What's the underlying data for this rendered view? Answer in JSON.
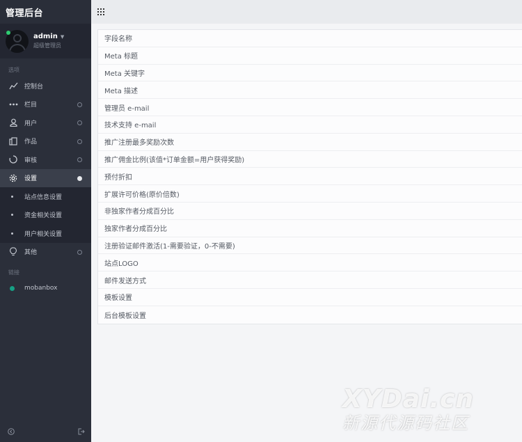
{
  "brand": {
    "title": "管理后台"
  },
  "profile": {
    "name": "admin",
    "role": "超级管理员"
  },
  "sidebar": {
    "section_options": "选项",
    "items": [
      {
        "label": "控制台",
        "icon": "chart-line-icon"
      },
      {
        "label": "栏目",
        "icon": "dots-icon"
      },
      {
        "label": "用户",
        "icon": "user-icon"
      },
      {
        "label": "作品",
        "icon": "copy-icon"
      },
      {
        "label": "审核",
        "icon": "spinner-icon"
      },
      {
        "label": "设置",
        "icon": "gear-icon"
      }
    ],
    "sub_items": [
      "站点信息设置",
      "资金相关设置",
      "用户相关设置"
    ],
    "other_label": "其他",
    "section_links": "链接",
    "link_label": "mobanbox"
  },
  "fields": [
    "字段名称",
    "Meta 标题",
    "Meta 关键字",
    "Meta 描述",
    "管理员 e-mail",
    "技术支持 e-mail",
    "推广注册最多奖励次数",
    "推广佣金比例(该值*订单金额=用户获得奖励)",
    "预付折扣",
    "扩展许可价格(原价倍数)",
    "非独家作者分成百分比",
    "独家作者分成百分比",
    "注册验证邮件激活(1-需要验证，0-不需要)",
    "站点LOGO",
    "邮件发送方式",
    "模板设置",
    "后台模板设置"
  ],
  "watermark": {
    "line1": "XYDai.cn",
    "line2": "新源代源码社区"
  },
  "colors": {
    "sidebar_bg": "#2b2f3a",
    "active_bg": "#3a3f4b",
    "online": "#2ecc71",
    "link_dot": "#16a085"
  }
}
